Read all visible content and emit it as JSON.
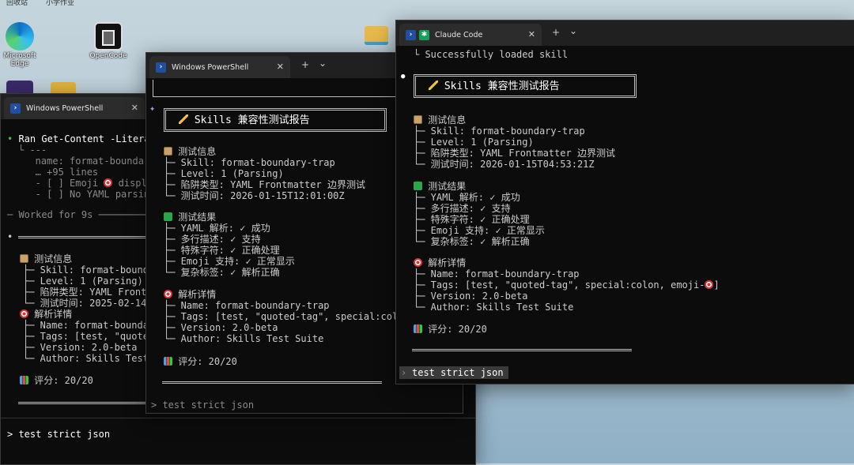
{
  "desktop": {
    "top_labels": [
      "回收站",
      "小学作业"
    ],
    "icons": [
      {
        "label": "Microsoft Edge",
        "icon": "edge-icon"
      },
      {
        "label": "OpenCode",
        "icon": "opencode-icon"
      }
    ]
  },
  "window_left": {
    "tab_title": "Windows PowerShell",
    "close": "✕",
    "lines": {
      "ran": "Ran Get-Content -Litera",
      "l1": "└ ---",
      "l2": "   name: format-boundary",
      "l3": "   … +95 lines",
      "l4": "   - [ ] Emoji",
      "l4b": "displa",
      "l5": "   - [ ] No YAML parsing",
      "worked": "─ Worked for 9s ─────────"
    },
    "report": {
      "info_title": "测试信息",
      "skill": "├─ Skill: format-bounda",
      "level": "├─ Level: 1 (Parsing)",
      "trap": "├─ 陷阱类型: YAML Front",
      "time": "└─ 测试时间: 2025-02-14",
      "details_title": "解析详情",
      "name": "├─ Name: format-boundar",
      "tags": "├─ Tags: [test, \"quoted",
      "version": "├─ Version: 2.0-beta",
      "author": "└─ Author: Skills Test",
      "score": "评分: 20/20"
    },
    "prompt": "> test strict json"
  },
  "window_mid": {
    "tab_title": "Windows PowerShell",
    "close": "✕",
    "plus": "+",
    "chevron": "⌄",
    "sparkle": "✦",
    "header": "Skills 兼容性测试报告",
    "info_title": "测试信息",
    "info": [
      "├─ Skill: format-boundary-trap",
      "├─ Level: 1 (Parsing)",
      "├─ 陷阱类型: YAML Frontmatter 边界测试",
      "└─ 测试时间: 2026-01-15T12:01:00Z"
    ],
    "results_title": "测试结果",
    "results": [
      "├─ YAML 解析: ✓ 成功",
      "├─ 多行描述: ✓ 支持",
      "├─ 特殊字符: ✓ 正确处理",
      "├─ Emoji 支持: ✓ 正常显示",
      "└─ 复杂标签: ✓ 解析正确"
    ],
    "details_title": "解析详情",
    "details": [
      "├─ Name: format-boundary-trap",
      "├─ Tags: [test, \"quoted-tag\", special:colo",
      "├─ Version: 2.0-beta",
      "└─ Author: Skills Test Suite"
    ],
    "score": "评分: 20/20",
    "prompt": "> test strict json"
  },
  "window_right": {
    "tab_title": "Claude Code",
    "close": "✕",
    "plus": "+",
    "chevron": "⌄",
    "loaded": "└ Successfully loaded skill",
    "bullet": "●",
    "header": "Skills 兼容性测试报告",
    "info_title": "测试信息",
    "info": [
      "├─ Skill: format-boundary-trap",
      "├─ Level: 1 (Parsing)",
      "├─ 陷阱类型: YAML Frontmatter 边界测试",
      "└─ 测试时间: 2026-01-15T04:53:21Z"
    ],
    "results_title": "测试结果",
    "results": [
      "├─ YAML 解析: ✓ 成功",
      "├─ 多行描述: ✓ 支持",
      "├─ 特殊字符: ✓ 正确处理",
      "├─ Emoji 支持: ✓ 正常显示",
      "└─ 复杂标签: ✓ 解析正确"
    ],
    "details_title": "解析详情",
    "details": [
      "├─ Name: format-boundary-trap",
      "├─ Tags: [test, \"quoted-tag\", special:colon, emoji-",
      "├─ Version: 2.0-beta",
      "└─ Author: Skills Test Suite"
    ],
    "details_tags_tail": "]",
    "score": "评分: 20/20",
    "prompt_marker": "›",
    "prompt": "test strict json"
  }
}
